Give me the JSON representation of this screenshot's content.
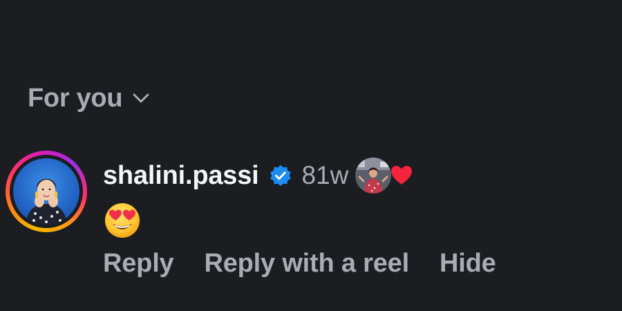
{
  "section": {
    "title": "For you",
    "icon": "chevron-down-icon"
  },
  "comment": {
    "username": "shalini.passi",
    "verified_icon": "verified-badge-icon",
    "time": "81w",
    "liked_by_author_icon": "heart-icon",
    "body_emoji": "smiling-face-with-heart-eyes-icon",
    "actions": {
      "reply": "Reply",
      "reply_with_reel": "Reply with a reel",
      "hide": "Hide"
    }
  },
  "colors": {
    "background": "#1b1d21",
    "primary_text": "#f4f5f7",
    "secondary_text": "#a8acb4",
    "verified_blue": "#1c8cf2",
    "heart_red": "#f3243b"
  }
}
